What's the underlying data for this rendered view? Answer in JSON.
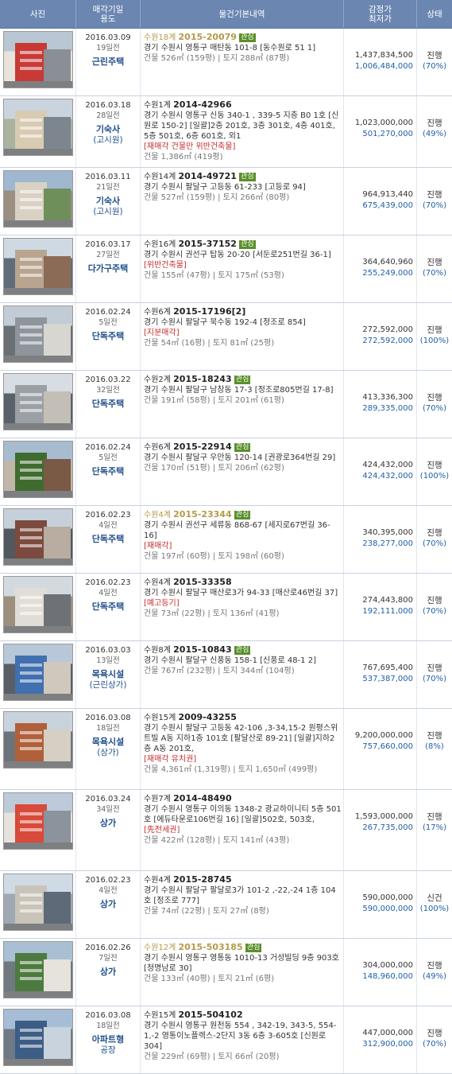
{
  "header": {
    "photo": "사진",
    "date_line1": "매각기일",
    "date_line2": "용도",
    "info": "물건기본내역",
    "price_line1": "감정가",
    "price_line2": "최저가",
    "status": "상태"
  },
  "badge_label": "관심",
  "rows": [
    {
      "date": "2016.03.09",
      "ago": "19일전",
      "use": "근린주택",
      "use2": "",
      "court": "수원18계",
      "case": "2015-20079",
      "badge": true,
      "hl": true,
      "addr": "경기 수원시 영통구 매탄동 101-8 [동수원로 51 1]",
      "tags": "",
      "area": "건물 526㎡ (159평) | 토지 288㎡ (87평)",
      "appraisal": "1,437,834,500",
      "minimum": "1,006,484,000",
      "status": "진행",
      "pct": "(70%)",
      "h": 85
    },
    {
      "date": "2016.03.18",
      "ago": "28일전",
      "use": "기숙사",
      "use2": "(고시원)",
      "court": "수원1계",
      "case": "2014-42966",
      "badge": false,
      "hl": false,
      "addr": "경기 수원시 영통구 신동 340-1 , 339-5 지층 B0 1호 [신원로 150-2] [일괄]2층 201호, 3층 301호, 4층 401호, 5층 501호, 6층 601호, 외1",
      "tags": "[재매각  건물만  위반건축물]",
      "area": "건물 1,386㎡ (419평)",
      "appraisal": "1,023,000,000",
      "minimum": "501,270,000",
      "status": "진행",
      "pct": "(49%)",
      "h": 90
    },
    {
      "date": "2016.03.11",
      "ago": "21일전",
      "use": "기숙사",
      "use2": "(고시원)",
      "court": "수원14계",
      "case": "2014-49721",
      "badge": true,
      "hl": false,
      "addr": "경기 수원시 팔달구 고등동 61-233 [고등로 94]",
      "tags": "",
      "area": "건물 527㎡ (159평) | 토지 266㎡ (80평)",
      "appraisal": "964,913,440",
      "minimum": "675,439,000",
      "status": "진행",
      "pct": "(70%)",
      "h": 85
    },
    {
      "date": "2016.03.17",
      "ago": "27일전",
      "use": "다가구주택",
      "use2": "",
      "court": "수원16계",
      "case": "2015-37152",
      "badge": true,
      "hl": false,
      "addr": "경기 수원시 권선구 탑동 20-20 [서둔로251번길 36-1]",
      "tags": "[위반건축물]",
      "area": "건물 155㎡ (47평) | 토지 175㎡ (53평)",
      "appraisal": "364,640,960",
      "minimum": "255,249,000",
      "status": "진행",
      "pct": "(70%)",
      "h": 85
    },
    {
      "date": "2016.02.24",
      "ago": "5일전",
      "use": "단독주택",
      "use2": "",
      "court": "수원6계",
      "case": "2015-17196[2]",
      "badge": false,
      "hl": false,
      "addr": "경기 수원시 팔달구 북수동 192-4 [정조로 854]",
      "tags": "[지분매각]",
      "area": "건물 54㎡ (16평) | 토지 81㎡ (25평)",
      "appraisal": "272,592,000",
      "minimum": "272,592,000",
      "status": "진행",
      "pct": "(100%)",
      "h": 85
    },
    {
      "date": "2016.03.22",
      "ago": "32일전",
      "use": "단독주택",
      "use2": "",
      "court": "수원2계",
      "case": "2015-18243",
      "badge": true,
      "hl": false,
      "addr": "경기 수원시 팔달구 남창동 17-3 [정조로805번길 17-8]",
      "tags": "",
      "area": "건물 191㎡ (58평) | 토지 201㎡ (61평)",
      "appraisal": "413,336,300",
      "minimum": "289,335,000",
      "status": "진행",
      "pct": "(70%)",
      "h": 85
    },
    {
      "date": "2016.02.24",
      "ago": "5일전",
      "use": "단독주택",
      "use2": "",
      "court": "수원6계",
      "case": "2015-22914",
      "badge": true,
      "hl": false,
      "addr": "경기 수원시 팔달구 우만동 120-14 [권광로364번길 29]",
      "tags": "",
      "area": "건물 170㎡ (51평) | 토지 206㎡ (62평)",
      "appraisal": "424,432,000",
      "minimum": "424,432,000",
      "status": "진행",
      "pct": "(100%)",
      "h": 85
    },
    {
      "date": "2016.02.23",
      "ago": "4일전",
      "use": "단독주택",
      "use2": "",
      "court": "수원4계",
      "case": "2015-23344",
      "badge": true,
      "hl": true,
      "addr": "경기 수원시 권선구 세류동 868-67 [세지로67번길 36-16]",
      "tags": "[재매각]",
      "area": "건물 197㎡ (60평) | 토지 198㎡ (60평)",
      "appraisal": "340,395,000",
      "minimum": "238,277,000",
      "status": "진행",
      "pct": "(70%)",
      "h": 85
    },
    {
      "date": "2016.02.23",
      "ago": "4일전",
      "use": "단독주택",
      "use2": "",
      "court": "수원4계",
      "case": "2015-33358",
      "badge": false,
      "hl": false,
      "addr": "경기 수원시 팔달구 매산로3가 94-33 [매산로46번길 37]",
      "tags": "[예고등기]",
      "area": "건물 73㎡ (22평) | 토지 136㎡ (41평)",
      "appraisal": "274,443,800",
      "minimum": "192,111,000",
      "status": "진행",
      "pct": "(70%)",
      "h": 85
    },
    {
      "date": "2016.03.03",
      "ago": "13일전",
      "use": "목욕시설",
      "use2": "(근린상가)",
      "court": "수원8계",
      "case": "2015-10843",
      "badge": true,
      "hl": false,
      "addr": "경기 수원시 팔달구 신풍동 158-1 [신풍로 48-1 2]",
      "tags": "",
      "area": "건물 767㎡ (232평) | 토지 344㎡ (104평)",
      "appraisal": "767,695,400",
      "minimum": "537,387,000",
      "status": "진행",
      "pct": "(70%)",
      "h": 85
    },
    {
      "date": "2016.03.08",
      "ago": "18일전",
      "use": "목욕시설",
      "use2": "(상가)",
      "court": "수원15계",
      "case": "2009-43255",
      "badge": false,
      "hl": false,
      "addr": "경기 수원시 팔달구 고등동 42-106 ,3-34,15-2 원평스위트빌 A동 지하1층 101호 [팔달산로 89-21] [일괄]지하2층 A동 201호,",
      "tags": "[재매각  유치권]",
      "area": "건물 4,361㎡ (1,319평) | 토지 1,650㎡ (499평)",
      "appraisal": "9,200,000,000",
      "minimum": "757,660,000",
      "status": "진행",
      "pct": "(8%)",
      "h": 102
    },
    {
      "date": "2016.03.24",
      "ago": "34일전",
      "use": "상가",
      "use2": "",
      "court": "수원7계",
      "case": "2014-48490",
      "badge": false,
      "hl": false,
      "addr": "경기 수원시 영통구 이의동 1348-2 광교하이니티 5층 501호 [에듀타운로106번길 16] [일괄]502호, 503호,",
      "tags": "[先전세권]",
      "area": "건물 422㎡ (128평) | 토지 141㎡ (43평)",
      "appraisal": "1,593,000,000",
      "minimum": "267,735,000",
      "status": "진행",
      "pct": "(17%)",
      "h": 102
    },
    {
      "date": "2016.02.23",
      "ago": "4일전",
      "use": "상가",
      "use2": "",
      "court": "수원4계",
      "case": "2015-28745",
      "badge": false,
      "hl": false,
      "addr": "경기 수원시 팔달구 팔달로3가 101-2 ,-22,-24 1층 104호 [정조로 777]",
      "tags": "",
      "area": "건물 74㎡ (22평) | 토지 27㎡ (8평)",
      "appraisal": "590,000,000",
      "minimum": "590,000,000",
      "status": "신건",
      "pct": "(100%)",
      "h": 85
    },
    {
      "date": "2016.02.26",
      "ago": "7일전",
      "use": "상가",
      "use2": "",
      "court": "수원12계",
      "case": "2015-503185",
      "badge": true,
      "hl": true,
      "addr": "경기 수원시 영통구 영통동 1010-13 거성빌딩 9층 903호 [청명남로 30]",
      "tags": "",
      "area": "건물 133㎡ (40평) | 토지 21㎡ (6평)",
      "appraisal": "304,000,000",
      "minimum": "148,960,000",
      "status": "진행",
      "pct": "(49%)",
      "h": 85
    },
    {
      "date": "2016.03.08",
      "ago": "18일전",
      "use": "아파트형",
      "use2": "공장",
      "court": "수원15계",
      "case": "2015-504102",
      "badge": false,
      "hl": false,
      "addr": "경기 수원시 영통구 원천동 554 , 342-19, 343-5, 554-1,-2 영통이노플렉스-2단지 3동 6층 3-605호 [신원로 304]",
      "tags": "",
      "area": "건물 229㎡ (69평) | 토지 66㎡ (20평)",
      "appraisal": "447,000,000",
      "minimum": "312,900,000",
      "status": "진행",
      "pct": "(70%)",
      "h": 85
    }
  ]
}
